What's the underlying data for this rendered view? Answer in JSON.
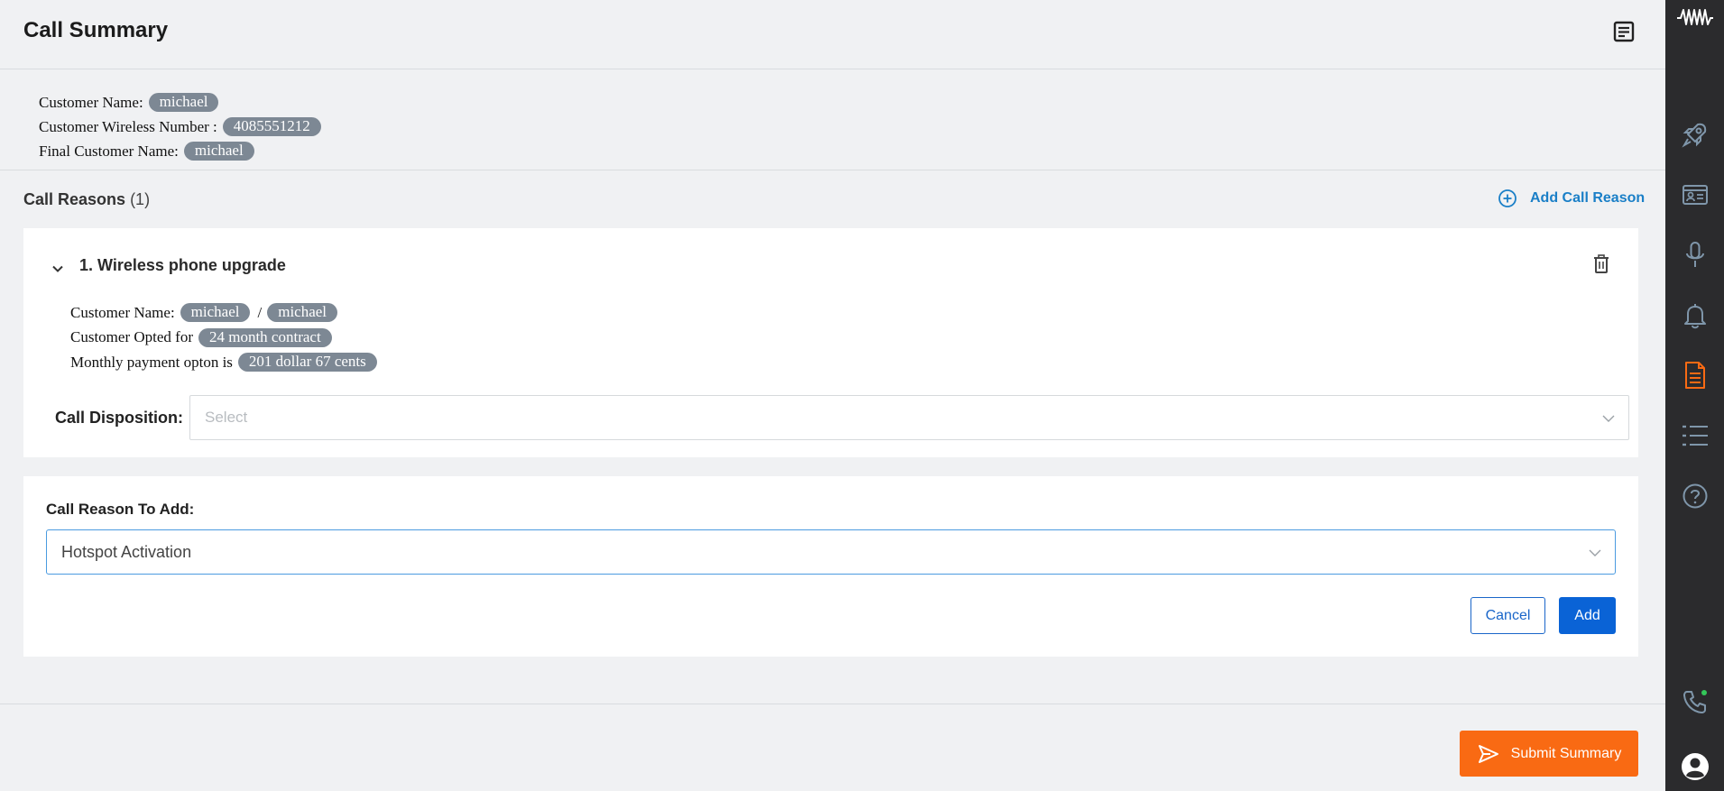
{
  "header": {
    "title": "Call Summary",
    "notes_icon": "notes-icon"
  },
  "summary": {
    "customer_name_label": "Customer Name:",
    "customer_name_value": "michael",
    "wireless_label": "Customer Wireless Number :",
    "wireless_value": "4085551212",
    "final_name_label": "Final Customer Name:",
    "final_name_value": "michael"
  },
  "call_reasons": {
    "title": "Call Reasons",
    "count": "(1)",
    "add_link": "Add Call Reason",
    "items": [
      {
        "title": "1. Wireless phone upgrade",
        "customer_name_label": "Customer Name:",
        "customer_name_value_1": "michael",
        "separator": "/",
        "customer_name_value_2": "michael",
        "opted_label": "Customer Opted for",
        "opted_value": "24 month contract",
        "payment_label": "Monthly payment opton is",
        "payment_value": "201 dollar 67 cents",
        "disposition_label": "Call Disposition:",
        "disposition_placeholder": "Select"
      }
    ]
  },
  "add_reason_form": {
    "label": "Call Reason To Add:",
    "selected": "Hotspot Activation",
    "cancel_label": "Cancel",
    "add_label": "Add"
  },
  "footer": {
    "submit_label": "Submit Summary"
  },
  "rail": {
    "items": [
      "waveform-logo-icon",
      "rocket-icon",
      "id-card-icon",
      "microphone-icon",
      "bell-icon",
      "document-icon",
      "list-icon",
      "help-icon",
      "phone-icon",
      "user-icon"
    ],
    "active_item": "document-icon",
    "active_color": "#f96a13",
    "status_dot_color": "#34c759"
  },
  "colors": {
    "accent_blue": "#0a63d6",
    "link_blue": "#1a7fc7",
    "submit_orange": "#f96a13",
    "pill_gray": "#7d8894",
    "rail_bg": "#2b2b2d"
  }
}
